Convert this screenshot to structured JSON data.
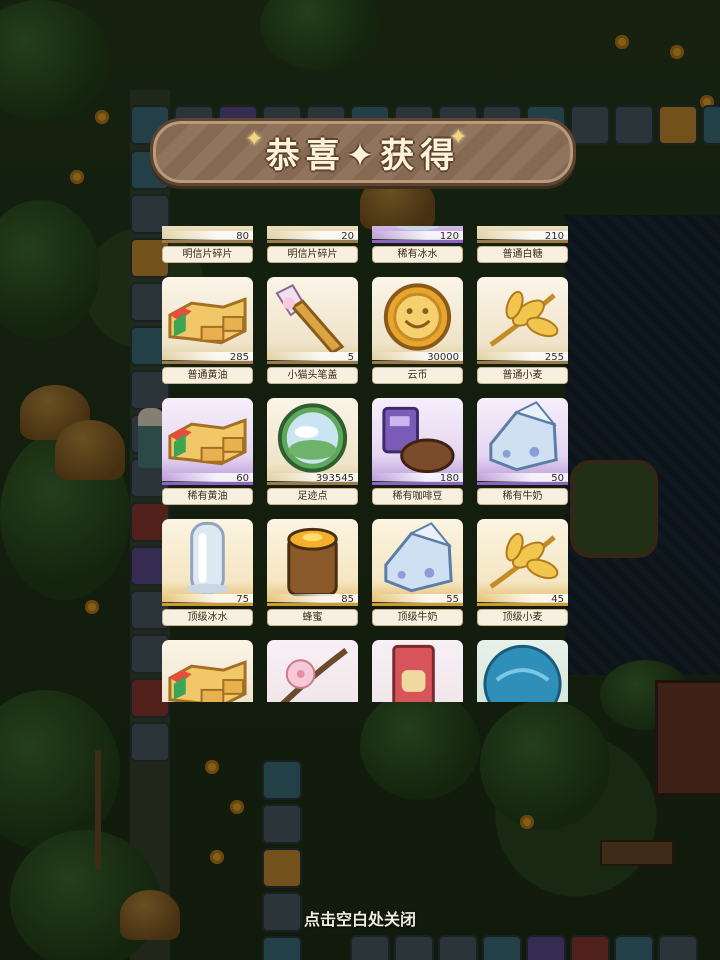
{
  "popup": {
    "title": "恭喜✦获得",
    "close_hint": "点击空白处关闭"
  },
  "items": [
    {
      "name": "明信片碎片",
      "qty": "80",
      "rarity": "common",
      "icon": "postcard-fragment-icon"
    },
    {
      "name": "明信片碎片",
      "qty": "20",
      "rarity": "common",
      "icon": "postcard-fragment-icon"
    },
    {
      "name": "稀有冰水",
      "qty": "120",
      "rarity": "rare",
      "icon": "ice-water-icon"
    },
    {
      "name": "普通白糖",
      "qty": "210",
      "rarity": "common",
      "icon": "white-sugar-icon"
    },
    {
      "name": "普通黄油",
      "qty": "285",
      "rarity": "common",
      "icon": "butter-icon"
    },
    {
      "name": "小猫头笔盖",
      "qty": "5",
      "rarity": "common",
      "icon": "cat-pen-cap-icon"
    },
    {
      "name": "云币",
      "qty": "30000",
      "rarity": "common",
      "icon": "cloud-coin-icon"
    },
    {
      "name": "普通小麦",
      "qty": "255",
      "rarity": "common",
      "icon": "wheat-icon"
    },
    {
      "name": "稀有黄油",
      "qty": "60",
      "rarity": "rare",
      "icon": "butter-icon"
    },
    {
      "name": "足迹点",
      "qty": "393545",
      "rarity": "common",
      "icon": "footprint-orb-icon"
    },
    {
      "name": "稀有咖啡豆",
      "qty": "180",
      "rarity": "rare",
      "icon": "coffee-bean-icon"
    },
    {
      "name": "稀有牛奶",
      "qty": "50",
      "rarity": "rare",
      "icon": "milk-carton-icon"
    },
    {
      "name": "顶级冰水",
      "qty": "75",
      "rarity": "top",
      "icon": "ice-water-icon"
    },
    {
      "name": "蜂蜜",
      "qty": "85",
      "rarity": "top",
      "icon": "honey-barrel-icon"
    },
    {
      "name": "顶级牛奶",
      "qty": "55",
      "rarity": "top",
      "icon": "milk-carton-icon"
    },
    {
      "name": "顶级小麦",
      "qty": "45",
      "rarity": "top",
      "icon": "wheat-icon"
    },
    {
      "name": "",
      "qty": "",
      "rarity": "common",
      "icon": "butter-icon"
    },
    {
      "name": "",
      "qty": "",
      "rarity": "pink",
      "icon": "cherry-blossom-icon"
    },
    {
      "name": "",
      "qty": "",
      "rarity": "pink",
      "icon": "red-bag-icon"
    },
    {
      "name": "",
      "qty": "",
      "rarity": "greenish",
      "icon": "blue-orb-icon"
    }
  ],
  "colors": {
    "banner": "#8a6d55",
    "common_accent": "#9c7a4a",
    "rare_accent": "#8e63c4",
    "top_accent": "#d09b2e"
  }
}
